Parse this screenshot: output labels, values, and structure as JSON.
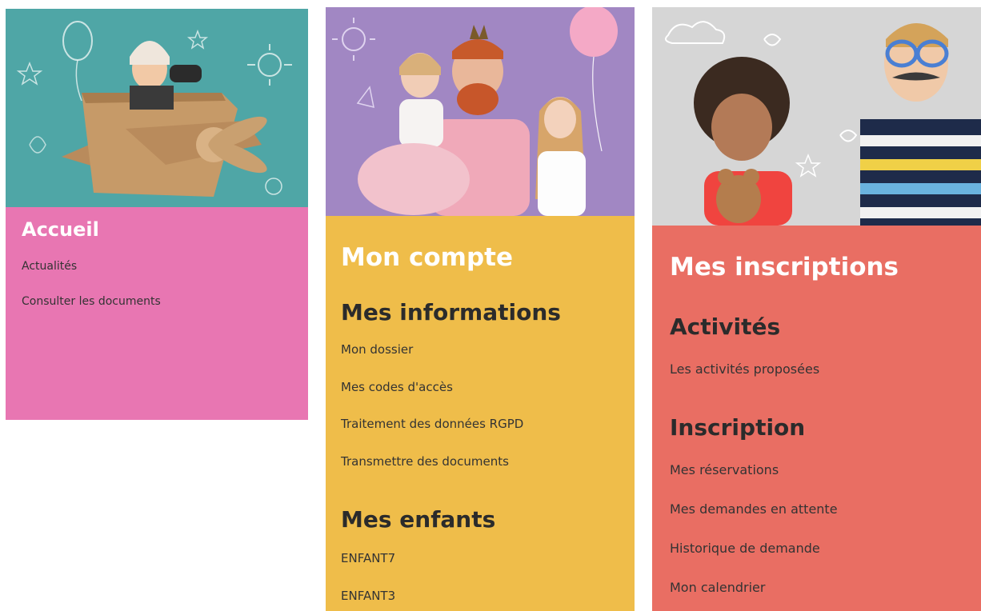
{
  "cards": [
    {
      "title": "Accueil",
      "links": [
        "Actualités",
        "Consulter les documents"
      ]
    },
    {
      "title": "Mon compte",
      "sections": [
        {
          "title": "Mes informations",
          "links": [
            "Mon dossier",
            "Mes codes d'accès",
            "Traitement des données RGPD",
            "Transmettre des documents"
          ]
        },
        {
          "title": "Mes enfants",
          "links": [
            "ENFANT7",
            "ENFANT3"
          ]
        }
      ]
    },
    {
      "title": "Mes inscriptions",
      "sections": [
        {
          "title": "Activités",
          "links": [
            "Les activités proposées"
          ]
        },
        {
          "title": "Inscription",
          "links": [
            "Mes réservations",
            "Mes demandes en attente",
            "Historique de demande",
            "Mon calendrier"
          ]
        }
      ]
    }
  ],
  "colors": {
    "accueil_panel": "#e876b2",
    "compte_panel": "#efbd4a",
    "inscriptions_panel": "#e96e63"
  },
  "images": [
    "child-in-cardboard-airplane-photo",
    "father-with-two-daughters-photo",
    "kids-with-photo-booth-props-photo"
  ]
}
